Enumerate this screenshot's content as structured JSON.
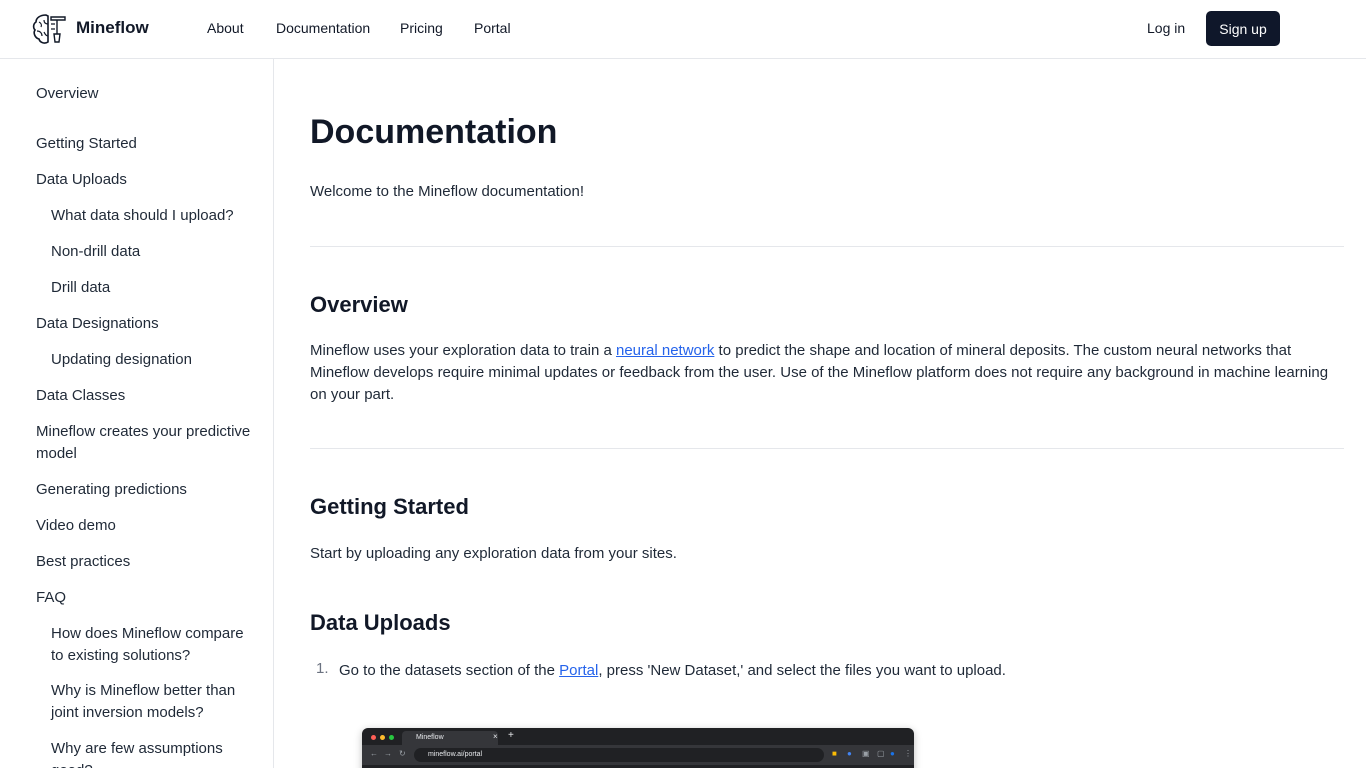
{
  "header": {
    "brand": "Mineflow",
    "nav": [
      "About",
      "Documentation",
      "Pricing",
      "Portal"
    ],
    "login": "Log in",
    "signup": "Sign up"
  },
  "sidebar": {
    "items": [
      {
        "label": "Overview",
        "level": 0
      },
      {
        "label": "Getting Started",
        "level": 0
      },
      {
        "label": "Data Uploads",
        "level": 0
      },
      {
        "label": "What data should I upload?",
        "level": 1
      },
      {
        "label": "Non-drill data",
        "level": 1
      },
      {
        "label": "Drill data",
        "level": 1
      },
      {
        "label": "Data Designations",
        "level": 0
      },
      {
        "label": "Updating designation",
        "level": 1
      },
      {
        "label": "Data Classes",
        "level": 0
      },
      {
        "label": "Mineflow creates your predictive model",
        "level": 0
      },
      {
        "label": "Generating predictions",
        "level": 0
      },
      {
        "label": "Video demo",
        "level": 0
      },
      {
        "label": "Best practices",
        "level": 0
      },
      {
        "label": "FAQ",
        "level": 0
      },
      {
        "label": "How does Mineflow compare to existing solutions?",
        "level": 1
      },
      {
        "label": "Why is Mineflow better than joint inversion models?",
        "level": 1
      },
      {
        "label": "Why are few assumptions good?",
        "level": 1
      }
    ]
  },
  "main": {
    "title": "Documentation",
    "welcome": "Welcome to the Mineflow documentation!",
    "overview": {
      "heading": "Overview",
      "text_before": "Mineflow uses your exploration data to train a ",
      "link": "neural network",
      "text_after": " to predict the shape and location of mineral deposits. The custom neural networks that Mineflow develops require minimal updates or feedback from the user. Use of the Mineflow platform does not require any background in machine learning on your part."
    },
    "getting_started": {
      "heading": "Getting Started",
      "text": "Start by uploading any exploration data from your sites."
    },
    "data_uploads": {
      "heading": "Data Uploads",
      "steps": [
        {
          "number": "1.",
          "text_before": "Go to the datasets section of the ",
          "link": "Portal",
          "text_after": ", press 'New Dataset,' and select the files you want to upload."
        }
      ]
    },
    "screenshot": {
      "tab_title": "Mineflow",
      "url": "mineflow.ai/portal"
    }
  }
}
